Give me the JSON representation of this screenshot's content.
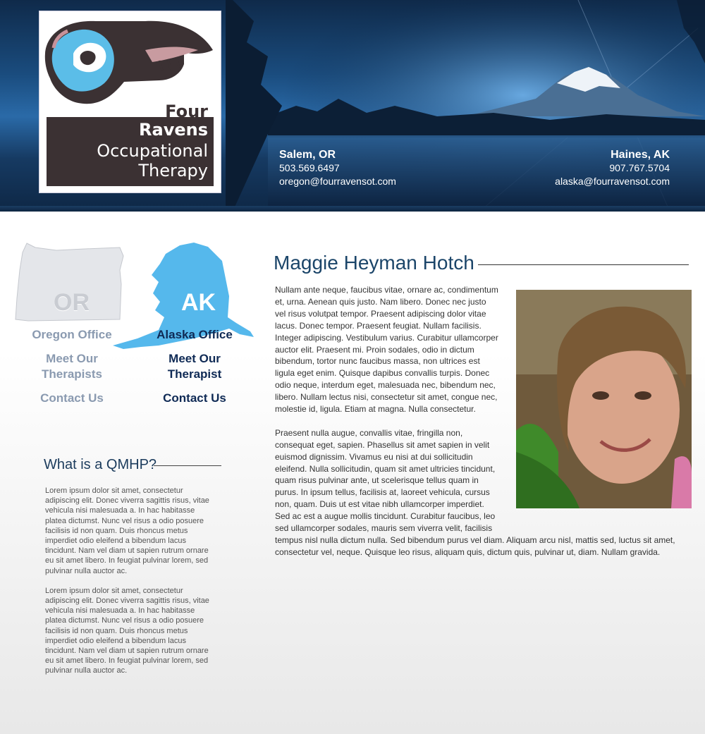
{
  "brand": {
    "logo_line1": "Four",
    "logo_line2": "Ravens",
    "logo_line3": "Occupational",
    "logo_line4": "Therapy"
  },
  "locations": {
    "left": {
      "city": "Salem, OR",
      "phone": "503.569.6497",
      "email": "oregon@fourravensot.com"
    },
    "right": {
      "city": "Haines, AK",
      "phone": "907.767.5704",
      "email": "alaska@fourravensot.com"
    }
  },
  "offices": {
    "oregon": {
      "map_label": "OR",
      "office_label": "Oregon Office",
      "meet_label": "Meet Our Therapists",
      "contact_label": "Contact Us"
    },
    "alaska": {
      "map_label": "AK",
      "office_label": "Alaska Office",
      "meet_label": "Meet Our Therapist",
      "contact_label": "Contact Us"
    }
  },
  "qmhp": {
    "title": "What is a QMHP?",
    "paragraphs": [
      "Lorem ipsum dolor sit amet, consectetur adipiscing elit. Donec viverra sagittis risus, vitae vehicula nisi malesuada a. In hac habitasse platea dictumst. Nunc vel risus a odio posuere facilisis id non quam. Duis rhoncus metus imperdiet odio eleifend a bibendum lacus tincidunt. Nam vel diam ut sapien rutrum ornare eu sit amet libero. In feugiat pulvinar lorem, sed pulvinar nulla auctor ac.",
      "Lorem ipsum dolor sit amet, consectetur adipiscing elit. Donec viverra sagittis risus, vitae vehicula nisi malesuada a. In hac habitasse platea dictumst. Nunc vel risus a odio posuere facilisis id non quam. Duis rhoncus metus imperdiet odio eleifend a bibendum lacus tincidunt. Nam vel diam ut sapien rutrum ornare eu sit amet libero. In feugiat pulvinar lorem, sed pulvinar nulla auctor ac."
    ]
  },
  "profile": {
    "name": "Maggie Heyman Hotch",
    "paragraphs": [
      "Nullam ante neque, faucibus vitae, ornare ac, condimentum et, urna. Aenean quis justo. Nam libero. Donec nec justo vel risus volutpat tempor. Praesent adipiscing dolor vitae lacus. Donec tempor. Praesent feugiat. Nullam facilisis. Integer adipiscing. Vestibulum varius. Curabitur ullamcorper auctor elit. Praesent mi. Proin sodales, odio in dictum bibendum, tortor nunc faucibus massa, non ultrices est ligula eget enim. Quisque dapibus convallis turpis. Donec odio neque, interdum eget, malesuada nec, bibendum nec, libero. Nullam lectus nisi, consectetur sit amet, congue nec, molestie id, ligula. Etiam at magna. Nulla consectetur.",
      "Praesent nulla augue, convallis vitae, fringilla non, consequat eget, sapien. Phasellus sit amet sapien in velit euismod dignissim. Vivamus eu nisi at dui sollicitudin eleifend. Nulla sollicitudin, quam sit amet ultricies tincidunt, quam risus pulvinar ante, ut scelerisque tellus quam in purus. In ipsum tellus, facilisis at, laoreet vehicula, cursus non, quam. Duis ut est vitae nibh ullamcorper imperdiet. Sed ac est a augue mollis tincidunt. Curabitur faucibus, leo sed ullamcorper sodales, mauris sem viverra velit, facilisis tempus nisl nulla dictum nulla. Sed bibendum purus vel diam. Aliquam arcu nisl, mattis sed, luctus sit amet, consectetur vel, neque. Quisque leo risus, aliquam quis, dictum quis, pulvinar ut, diam. Nullam gravida."
    ]
  },
  "colors": {
    "header_navy": "#0f2a4a",
    "alaska_blue": "#55b8ec",
    "oregon_gray": "#d8dbe0",
    "title_blue": "#1b4569"
  }
}
